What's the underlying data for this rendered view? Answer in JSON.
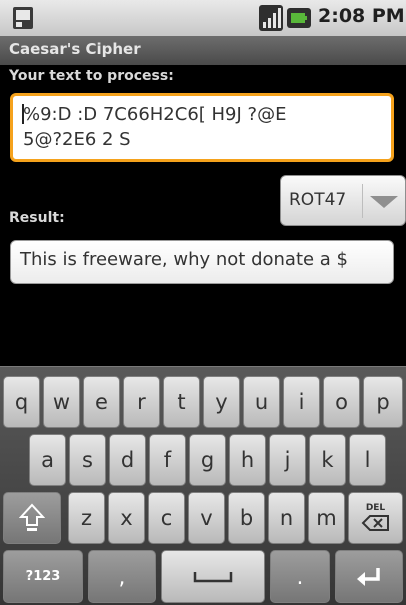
{
  "status_bar": {
    "time": "2:08 PM",
    "icons": [
      "sim-card-icon",
      "signal-icon",
      "battery-icon"
    ]
  },
  "app": {
    "title": "Caesar's Cipher"
  },
  "input": {
    "label": "Your text to process:",
    "value": "%9:D :D 7C66H2C6[ H9J ?@E\n5@?2E6 2 S"
  },
  "cipher_select": {
    "selected": "ROT47"
  },
  "result": {
    "label": "Result:",
    "value": "This is freeware, why not donate a $"
  },
  "keyboard": {
    "row1": [
      "q",
      "w",
      "e",
      "r",
      "t",
      "y",
      "u",
      "i",
      "o",
      "p"
    ],
    "row2": [
      "a",
      "s",
      "d",
      "f",
      "g",
      "h",
      "j",
      "k",
      "l"
    ],
    "row3": [
      "z",
      "x",
      "c",
      "v",
      "b",
      "n",
      "m"
    ],
    "symbols_label": "?123",
    "comma_label": ",",
    "period_label": ".",
    "del_label": "DEL",
    "icons": [
      "shift-icon",
      "delete-icon",
      "space-icon",
      "enter-icon"
    ]
  }
}
